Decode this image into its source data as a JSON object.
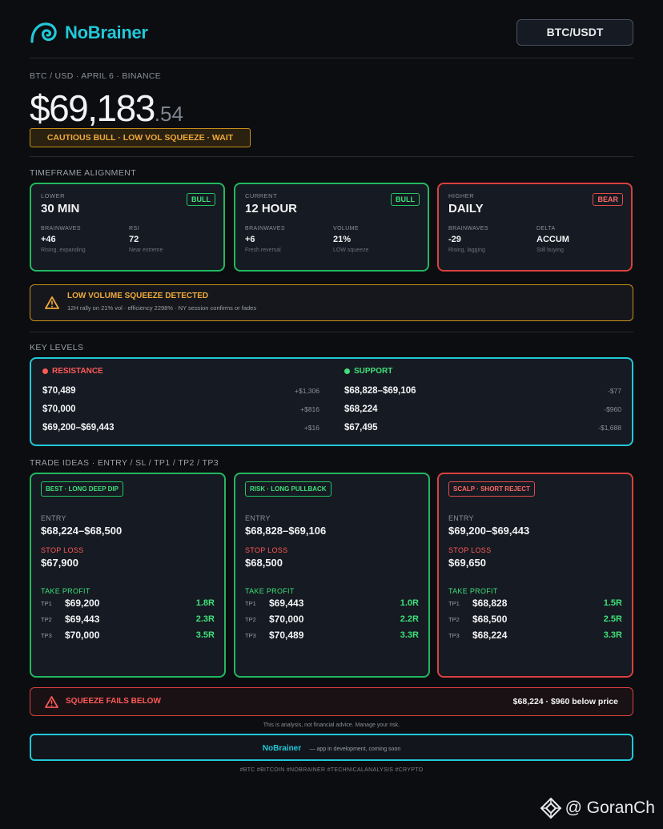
{
  "brand": {
    "name": "NoBrainer",
    "pair_button": "BTC/USDT"
  },
  "meta": "BTC / USD  ·  APRIL 6  ·  BINANCE",
  "price": {
    "main": "$69,183",
    "cents": ".54"
  },
  "signal": "CAUTIOUS BULL  ·  LOW VOL SQUEEZE  ·  WAIT",
  "timeframe": {
    "title": "TIMEFRAME ALIGNMENT",
    "cards": [
      {
        "sub": "LOWER",
        "title": "30 MIN",
        "tag": "BULL",
        "s1_label": "BRAINWAVES",
        "s1_val": "+46",
        "s1_note": "Rising, expanding",
        "s2_label": "RSI",
        "s2_val": "72",
        "s2_note": "Near extreme"
      },
      {
        "sub": "CURRENT",
        "title": "12 HOUR",
        "tag": "BULL",
        "s1_label": "BRAINWAVES",
        "s1_val": "+6",
        "s1_note": "Fresh reversal",
        "s2_label": "VOLUME",
        "s2_val": "21%",
        "s2_note": "LOW squeeze"
      },
      {
        "sub": "HIGHER",
        "title": "DAILY",
        "tag": "BEAR",
        "s1_label": "BRAINWAVES",
        "s1_val": "-29",
        "s1_note": "Rising, lagging",
        "s2_label": "DELTA",
        "s2_val": "ACCUM",
        "s2_note": "Still buying"
      }
    ]
  },
  "alert": {
    "title": "LOW VOLUME SQUEEZE DETECTED",
    "text": "12H rally on 21% vol  ·  efficiency 2298%  ·  NY session confirms or fades"
  },
  "levels": {
    "title": "KEY LEVELS",
    "resistance_label": "RESISTANCE",
    "support_label": "SUPPORT",
    "resistance": [
      {
        "price": "$70,489",
        "delta": "+$1,306"
      },
      {
        "price": "$70,000",
        "delta": "+$816"
      },
      {
        "price": "$69,200–$69,443",
        "delta": "+$16"
      }
    ],
    "support": [
      {
        "price": "$68,828–$69,106",
        "delta": "-$77"
      },
      {
        "price": "$68,224",
        "delta": "-$960"
      },
      {
        "price": "$67,495",
        "delta": "-$1,688"
      }
    ]
  },
  "trades": {
    "title": "TRADE IDEAS  ·  ENTRY / SL / TP1 / TP2 / TP3",
    "entry_label": "ENTRY",
    "stop_label": "STOP LOSS",
    "tp_label": "TAKE PROFIT",
    "cards": [
      {
        "tag": "BEST  ·  LONG DEEP DIP",
        "entry": "$68,224–$68,500",
        "stop": "$67,900",
        "tps": [
          {
            "name": "TP1",
            "price": "$69,200",
            "r": "1.8R"
          },
          {
            "name": "TP2",
            "price": "$69,443",
            "r": "2.3R"
          },
          {
            "name": "TP3",
            "price": "$70,000",
            "r": "3.5R"
          }
        ]
      },
      {
        "tag": "RISK  ·  LONG PULLBACK",
        "entry": "$68,828–$69,106",
        "stop": "$68,500",
        "tps": [
          {
            "name": "TP1",
            "price": "$69,443",
            "r": "1.0R"
          },
          {
            "name": "TP2",
            "price": "$70,000",
            "r": "2.2R"
          },
          {
            "name": "TP3",
            "price": "$70,489",
            "r": "3.3R"
          }
        ]
      },
      {
        "tag": "SCALP  ·  SHORT REJECT",
        "entry": "$69,200–$69,443",
        "stop": "$69,650",
        "tps": [
          {
            "name": "TP1",
            "price": "$68,828",
            "r": "1.5R"
          },
          {
            "name": "TP2",
            "price": "$68,500",
            "r": "2.5R"
          },
          {
            "name": "TP3",
            "price": "$68,224",
            "r": "3.3R"
          }
        ]
      }
    ]
  },
  "fail": {
    "title": "SQUEEZE FAILS BELOW",
    "right": "$68,224  ·  $960 below price"
  },
  "disclaimer": "This is analysis, not financial advice. Manage your risk.",
  "footer": {
    "brand": "NoBrainer",
    "note": "— app in development, coming soon"
  },
  "hashtags": "#BTC  #BITCOIN  #NOBRAINER  #TECHNICALANALYSIS  #CRYPTO",
  "watermark": "@ GoranCh",
  "colors": {
    "accent": "#22c8d8",
    "bull": "#3ee07a",
    "bear": "#ff5a57",
    "warn": "#f0a93a",
    "bg": "#0b0d10"
  }
}
